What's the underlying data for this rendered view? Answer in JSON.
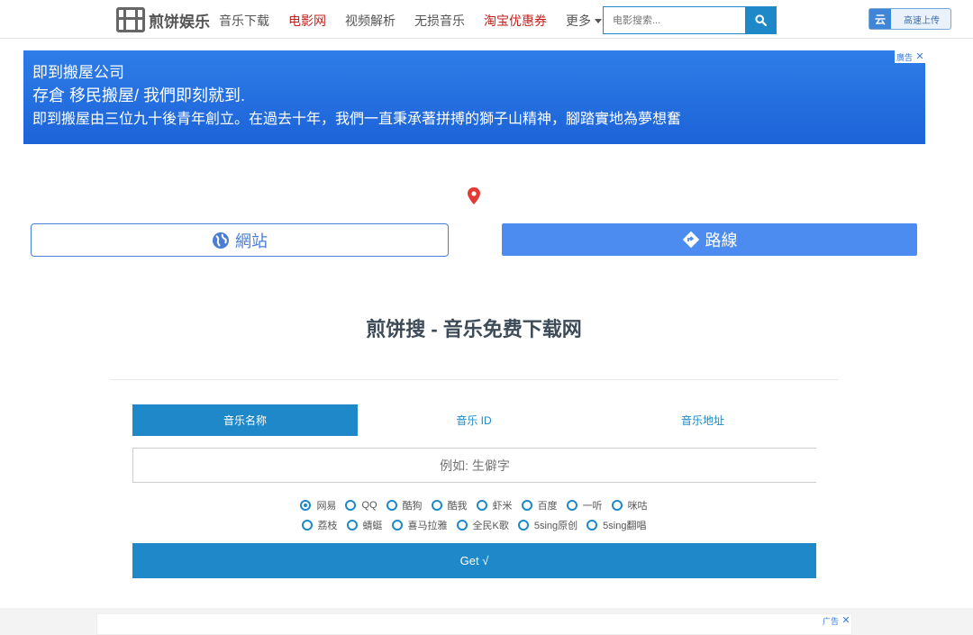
{
  "header": {
    "logo_text": "煎饼娱乐",
    "nav": [
      {
        "label": "音乐下载",
        "color": "#555555"
      },
      {
        "label": "电影网",
        "color": "#c0231f"
      },
      {
        "label": "视频解析",
        "color": "#555555"
      },
      {
        "label": "无损音乐",
        "color": "#555555"
      },
      {
        "label": "淘宝优惠券",
        "color": "#c0231f"
      },
      {
        "label": "更多",
        "color": "#555555"
      }
    ],
    "search_placeholder": "电影搜索...",
    "search_icon": "search-icon",
    "upload_icon_text": "云",
    "upload_label": "高速上传"
  },
  "ad_top": {
    "line1": "即到搬屋公司",
    "line2": "存倉 移民搬屋/ 我們即刻就到.",
    "line3": "即到搬屋由三位九十後青年創立。在過去十年，我們一直秉承著拼搏的獅子山精神，腳踏實地為夢想奮",
    "tag": "廣告",
    "close": "✕"
  },
  "location_buttons": {
    "site_label": "網站",
    "route_label": "路線"
  },
  "main": {
    "title": "煎饼搜 - 音乐免费下载网",
    "tabs": [
      {
        "label": "音乐名称",
        "active": true
      },
      {
        "label": "音乐 ID",
        "active": false
      },
      {
        "label": "音乐地址",
        "active": false
      }
    ],
    "input_placeholder": "例如: 生僻字",
    "sources_row1": [
      {
        "label": "网易",
        "checked": true
      },
      {
        "label": "QQ",
        "checked": false
      },
      {
        "label": "酷狗",
        "checked": false
      },
      {
        "label": "酷我",
        "checked": false
      },
      {
        "label": "虾米",
        "checked": false
      },
      {
        "label": "百度",
        "checked": false
      },
      {
        "label": "一听",
        "checked": false
      },
      {
        "label": "咪咕",
        "checked": false
      }
    ],
    "sources_row2": [
      {
        "label": "荔枝",
        "checked": false
      },
      {
        "label": "蜻蜓",
        "checked": false
      },
      {
        "label": "喜马拉雅",
        "checked": false
      },
      {
        "label": "全民K歌",
        "checked": false
      },
      {
        "label": "5sing原创",
        "checked": false
      },
      {
        "label": "5sing翻唱",
        "checked": false
      }
    ],
    "submit_label": "Get √"
  },
  "ad_bottom": {
    "tag": "广告",
    "close": "✕"
  },
  "colors": {
    "accent": "#1e88c8",
    "route_button": "#4c8cf0",
    "ad_background": "#2e7de8"
  }
}
